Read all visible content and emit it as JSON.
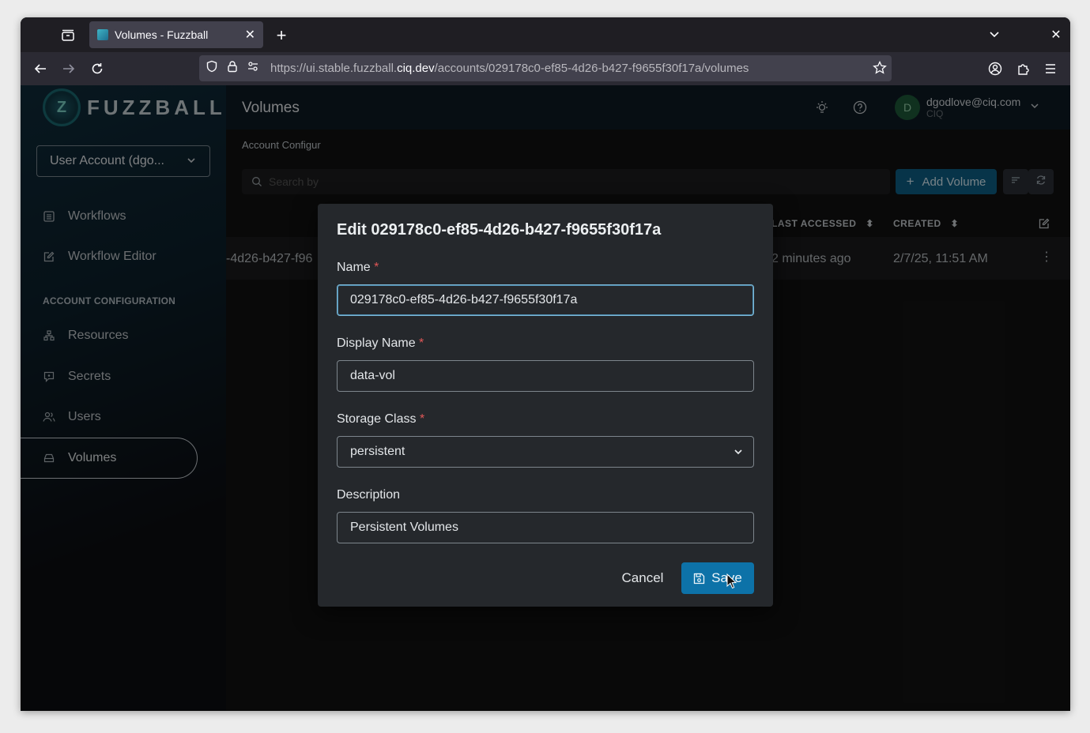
{
  "browser": {
    "tab_title": "Volumes - Fuzzball",
    "url_prefix": "https://ui.stable.fuzzball.",
    "url_domain": "ciq.dev",
    "url_path": "/accounts/029178c0-ef85-4d26-b427-f9655f30f17a/volumes"
  },
  "sidebar": {
    "logo_text": "FUZZBALL",
    "logo_mark": "Z",
    "account_select": "User Account (dgo...",
    "items": [
      {
        "label": "Workflows",
        "icon": "list-icon"
      },
      {
        "label": "Workflow Editor",
        "icon": "edit-icon"
      }
    ],
    "section_label": "ACCOUNT CONFIGURATION",
    "config_items": [
      {
        "label": "Resources",
        "icon": "resources-icon"
      },
      {
        "label": "Secrets",
        "icon": "secrets-icon"
      },
      {
        "label": "Users",
        "icon": "users-icon"
      },
      {
        "label": "Volumes",
        "icon": "volume-icon",
        "active": true
      }
    ]
  },
  "header": {
    "title": "Volumes",
    "user_initial": "D",
    "user_email": "dgodlove@ciq.com",
    "user_org": "CIQ"
  },
  "main": {
    "breadcrumb": "Account Configur",
    "search_placeholder": "Search by",
    "add_button": "Add Volume",
    "columns": {
      "last_accessed": "LAST ACCESSED",
      "created": "CREATED"
    },
    "row": {
      "name_fragment": "-4d26-b427-f96",
      "last_accessed": "2 minutes ago",
      "created": "2/7/25, 11:51 AM"
    }
  },
  "dialog": {
    "title": "Edit 029178c0-ef85-4d26-b427-f9655f30f17a",
    "name_label": "Name",
    "name_value": "029178c0-ef85-4d26-b427-f9655f30f17a",
    "display_name_label": "Display Name",
    "display_name_value": "data-vol",
    "storage_class_label": "Storage Class",
    "storage_class_value": "persistent",
    "description_label": "Description",
    "description_value": "Persistent Volumes",
    "required_mark": "*",
    "cancel_label": "Cancel",
    "save_label": "Save"
  },
  "colors": {
    "accent": "#0d72a8",
    "required": "#e05757"
  }
}
